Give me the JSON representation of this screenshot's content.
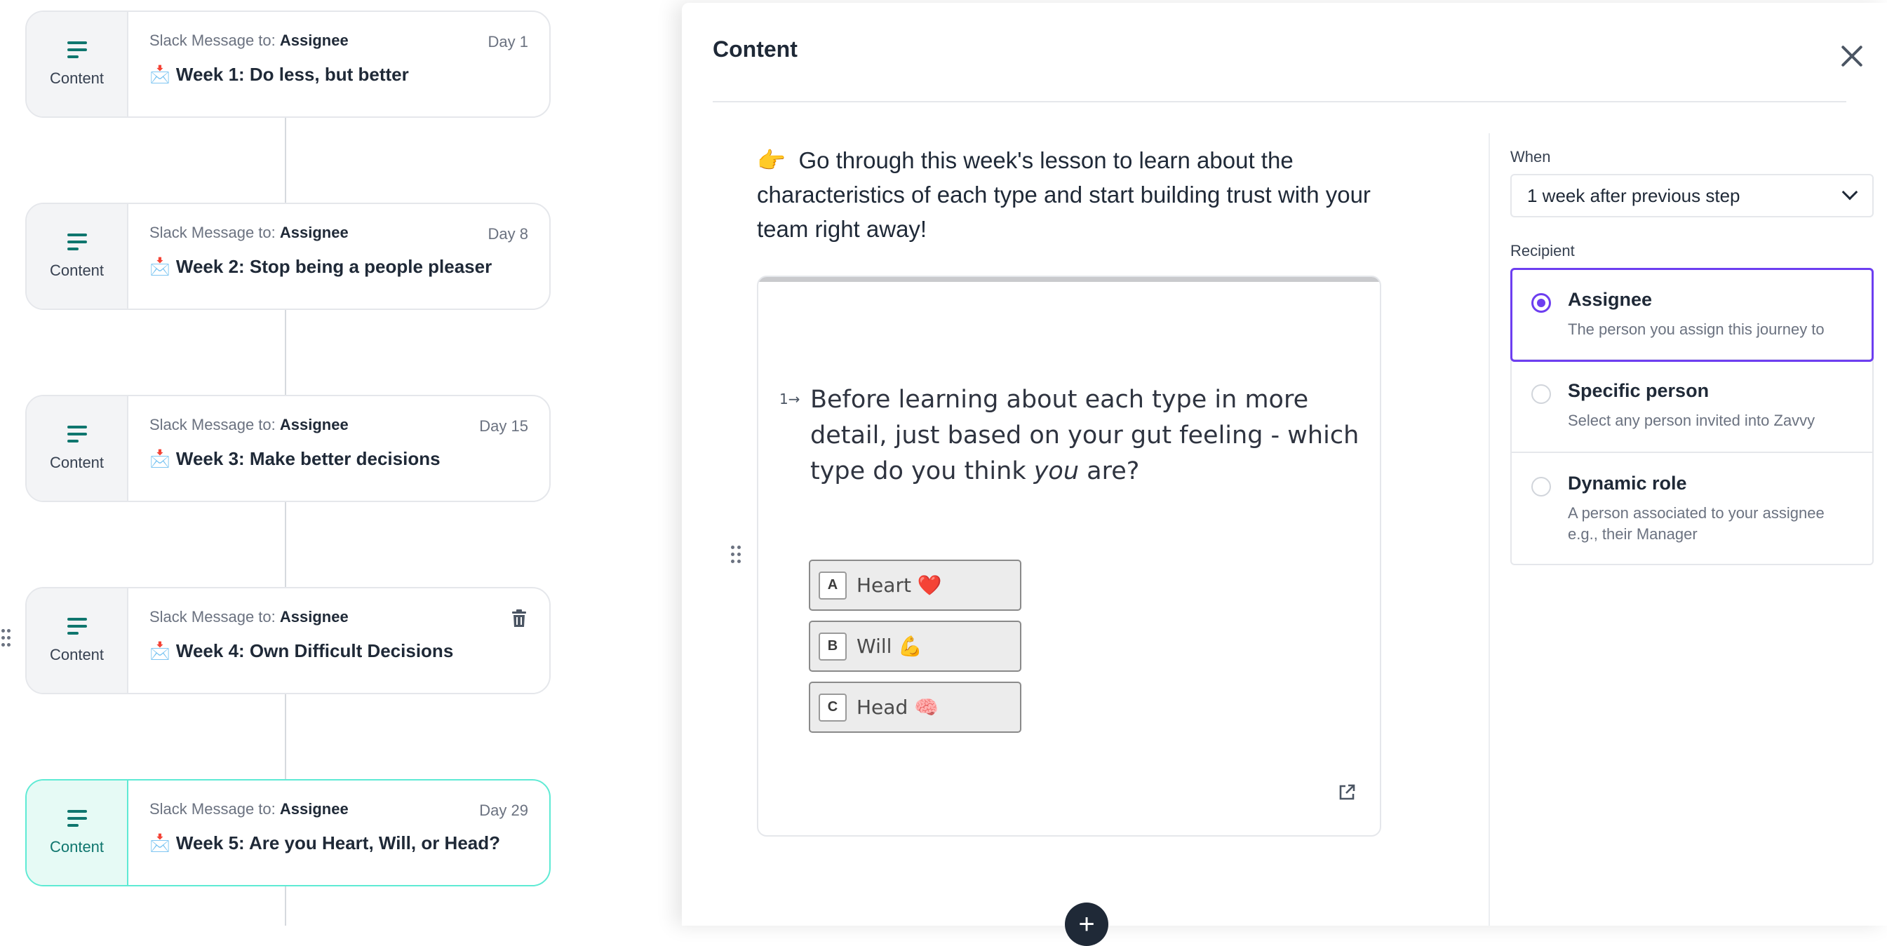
{
  "timeline": {
    "cards": [
      {
        "type_label": "Content",
        "prefix": "Slack Message to:",
        "recipient": "Assignee",
        "day": "Day 1",
        "emoji": "📩",
        "title": "Week 1: Do less, but better"
      },
      {
        "type_label": "Content",
        "prefix": "Slack Message to:",
        "recipient": "Assignee",
        "day": "Day 8",
        "emoji": "📩",
        "title": "Week 2: Stop being a people pleaser"
      },
      {
        "type_label": "Content",
        "prefix": "Slack Message to:",
        "recipient": "Assignee",
        "day": "Day 15",
        "emoji": "📩",
        "title": "Week 3: Make better decisions"
      },
      {
        "type_label": "Content",
        "prefix": "Slack Message to:",
        "recipient": "Assignee",
        "day": "",
        "emoji": "📩",
        "title": "Week 4: Own Difficult Decisions"
      },
      {
        "type_label": "Content",
        "prefix": "Slack Message to:",
        "recipient": "Assignee",
        "day": "Day 29",
        "emoji": "📩",
        "title": "Week 5: Are you Heart, Will, or Head?"
      }
    ]
  },
  "panel": {
    "title": "Content",
    "intro_emoji": "👉",
    "intro_text": "Go through this week's lesson to learn about the characteristics of each type and start building trust with your team right away!",
    "form": {
      "question_number": "1→",
      "question_before": "Before learning about each type in more detail, just based on your gut feeling - which type do you think ",
      "question_emphasis": "you",
      "question_after": " are?",
      "choices": [
        {
          "key": "A",
          "label": "Heart ❤️"
        },
        {
          "key": "B",
          "label": "Will 💪"
        },
        {
          "key": "C",
          "label": "Head 🧠"
        }
      ]
    },
    "add_button": "+",
    "settings": {
      "when_label": "When",
      "when_value": "1 week after previous step",
      "recipient_label": "Recipient",
      "options": [
        {
          "title": "Assignee",
          "description": "The person you assign this journey to",
          "selected": true
        },
        {
          "title": "Specific person",
          "description": "Select any person invited into Zavvy",
          "selected": false
        },
        {
          "title": "Dynamic role",
          "description": "A person associated to your assignee e.g., their Manager",
          "selected": false
        }
      ]
    }
  },
  "colors": {
    "accent_teal": "#0f766e",
    "active_border": "#5eead4",
    "selected_purple": "#6d3ef0"
  },
  "icons": [
    "content-icon",
    "envelope-icon",
    "trash-icon",
    "drag-handle-icon",
    "close-icon",
    "external-link-icon",
    "plus-icon",
    "chevron-down-icon"
  ]
}
